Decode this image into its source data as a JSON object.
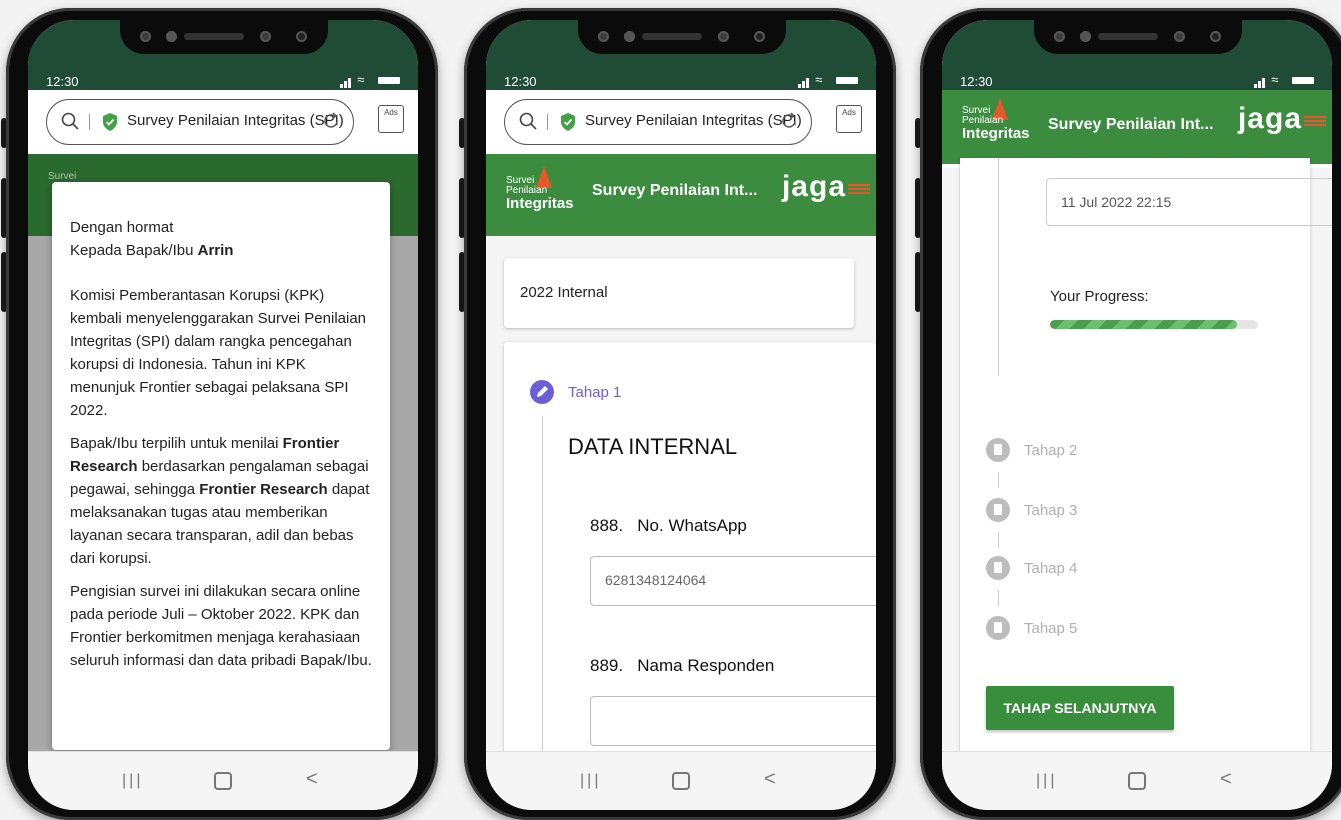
{
  "status": {
    "time": "12:30"
  },
  "browser": {
    "url_text": "Survey Penilaian Integritas (SPI)",
    "ads_label": "Ads"
  },
  "app": {
    "logo_line1": "Survei",
    "logo_line2": "Penilaian",
    "logo_line3": "Integritas",
    "title": "Survey Penilaian Int...",
    "partner_logo": "jaga"
  },
  "modal": {
    "greeting": "Dengan hormat",
    "addressee_prefix": "Kepada Bapak/Ibu ",
    "addressee_name": "Arrin",
    "para1": "Komisi Pemberantasan Korupsi (KPK) kembali menyelenggarakan Survei Penilaian Integritas (SPI) dalam rangka pencegahan korupsi di Indonesia. Tahun ini KPK menunjuk Frontier sebagai pelaksana SPI 2022.",
    "para2_a": "Bapak/Ibu terpilih untuk menilai ",
    "para2_b": "Frontier Research",
    "para2_c": " berdasarkan pengalaman sebagai pegawai, sehingga ",
    "para2_d": "Frontier Research",
    "para2_e": " dapat melaksanakan tugas atau memberikan layanan secara transparan, adil dan bebas dari korupsi.",
    "para3": "Pengisian survei ini dilakukan secara online pada periode Juli – Oktober 2022. KPK dan Frontier berkomitmen menjaga kerahasiaan seluruh informasi dan data pribadi Bapak/Ibu."
  },
  "form": {
    "category": "2022 Internal",
    "step_label": "Tahap 1",
    "section_title": "DATA INTERNAL",
    "q1_number": "888.",
    "q1_label": "No. WhatsApp",
    "q1_value": "6281348124064",
    "q2_number": "889.",
    "q2_label": "Nama Responden",
    "q2_value": ""
  },
  "progress": {
    "date_value": "11 Jul 2022 22:15",
    "label": "Your Progress:",
    "fraction": 0.9,
    "steps": [
      "Tahap 2",
      "Tahap 3",
      "Tahap 4",
      "Tahap 5"
    ],
    "next_button": "TAHAP SELANJUTNYA"
  },
  "nav": {
    "recent": "|||",
    "back": "<"
  },
  "colors": {
    "header_green": "#3b8c3f",
    "status_bar": "#1f4b37",
    "step_active": "#6b5fd8",
    "button_green": "#388e3c"
  }
}
